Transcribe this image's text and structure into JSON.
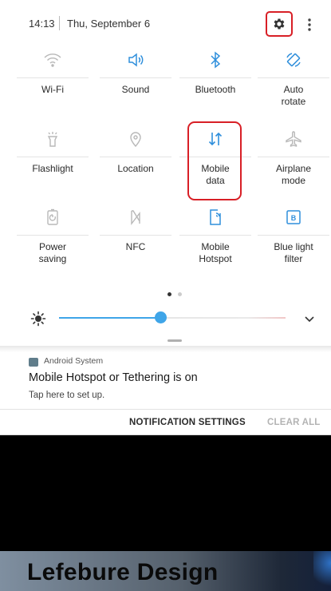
{
  "status": {
    "time": "14:13",
    "date": "Thu, September 6"
  },
  "toggles": [
    {
      "label_lines": [
        "Wi-Fi"
      ],
      "icon": "wifi-icon",
      "active": false
    },
    {
      "label_lines": [
        "Sound"
      ],
      "icon": "sound-icon",
      "active": true
    },
    {
      "label_lines": [
        "Bluetooth"
      ],
      "icon": "bluetooth-icon",
      "active": true
    },
    {
      "label_lines": [
        "Auto",
        "rotate"
      ],
      "icon": "auto-rotate-icon",
      "active": true
    },
    {
      "label_lines": [
        "Flashlight"
      ],
      "icon": "flashlight-icon",
      "active": false
    },
    {
      "label_lines": [
        "Location"
      ],
      "icon": "location-icon",
      "active": false
    },
    {
      "label_lines": [
        "Mobile",
        "data"
      ],
      "icon": "mobile-data-icon",
      "active": true
    },
    {
      "label_lines": [
        "Airplane",
        "mode"
      ],
      "icon": "airplane-icon",
      "active": false
    },
    {
      "label_lines": [
        "Power",
        "saving"
      ],
      "icon": "power-saving-icon",
      "active": false
    },
    {
      "label_lines": [
        "NFC"
      ],
      "icon": "nfc-icon",
      "active": false
    },
    {
      "label_lines": [
        "Mobile",
        "Hotspot"
      ],
      "icon": "mobile-hotspot-icon",
      "active": true
    },
    {
      "label_lines": [
        "Blue light",
        "filter"
      ],
      "icon": "blue-light-filter-icon",
      "active": true
    }
  ],
  "pager": {
    "pages": 2,
    "current": 1
  },
  "brightness": {
    "level": 0.35
  },
  "notification": {
    "app_name": "Android System",
    "title": "Mobile Hotspot or Tethering is on",
    "body": "Tap here to set up."
  },
  "actions": {
    "settings_label": "NOTIFICATION SETTINGS",
    "clear_label": "CLEAR ALL"
  },
  "banner": {
    "text": "Lefebure Design"
  },
  "colors": {
    "active": "#2f8fdc",
    "inactive": "#b8b8b8",
    "highlight": "#d81f26",
    "slider": "#3fa5e8"
  }
}
